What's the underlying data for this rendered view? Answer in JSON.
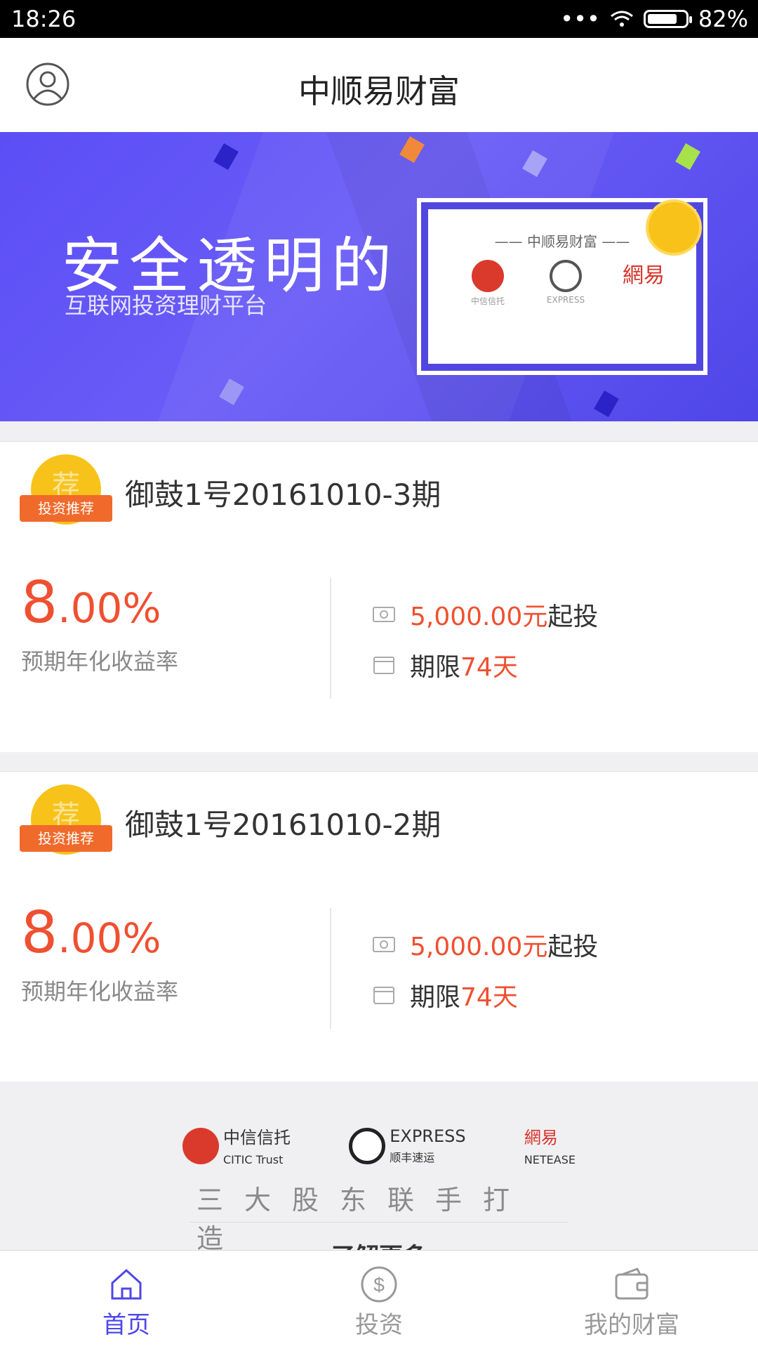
{
  "status_bar": {
    "time": "18:26",
    "battery": "82%",
    "battery_level": 0.82
  },
  "header": {
    "title": "中顺易财富",
    "avatar_icon": "user-circle-icon"
  },
  "banner": {
    "headline": "安全透明的",
    "subline": "互联网投资理财平台",
    "certificate_title": "—— 中顺易财富 ——",
    "certificate_logos": [
      "中信信托",
      "EXPRESS",
      "網易"
    ]
  },
  "products": [
    {
      "badge_char": "荐",
      "badge_text": "投资推荐",
      "title": "御鼓1号20161010-3期",
      "rate_int": "8",
      "rate_dec": ".00%",
      "rate_label": "预期年化收益率",
      "min_amount": "5,000.00元",
      "min_suffix": "起投",
      "term_prefix": "期限",
      "term_value": "74天"
    },
    {
      "badge_char": "荐",
      "badge_text": "投资推荐",
      "title": "御鼓1号20161010-2期",
      "rate_int": "8",
      "rate_dec": ".00%",
      "rate_label": "预期年化收益率",
      "min_amount": "5,000.00元",
      "min_suffix": "起投",
      "term_prefix": "期限",
      "term_value": "74天"
    }
  ],
  "footer": {
    "shareholders": [
      {
        "name": "中信信托",
        "sub": "CITIC Trust"
      },
      {
        "name": "EXPRESS",
        "sub": "顺丰速运"
      },
      {
        "name": "網易",
        "sub": "NETEASE"
      }
    ],
    "tagline": "三大股东联手打造",
    "learn_more": "了解更多"
  },
  "tabbar": {
    "tabs": [
      {
        "label": "首页",
        "icon": "home-icon",
        "active": true
      },
      {
        "label": "投资",
        "icon": "dollar-coin-icon",
        "active": false
      },
      {
        "label": "我的财富",
        "icon": "wallet-icon",
        "active": false
      }
    ]
  },
  "colors": {
    "accent": "#4f46e8",
    "highlight": "#ef5031",
    "badge": "#f7c31a"
  }
}
